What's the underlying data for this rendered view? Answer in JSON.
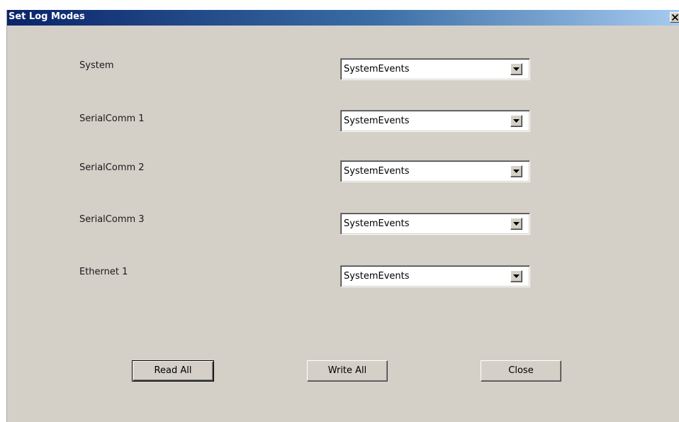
{
  "window": {
    "title": "Set Log Modes",
    "close_glyph": "X"
  },
  "rows": [
    {
      "label": "System",
      "value": "SystemEvents"
    },
    {
      "label": "SerialComm 1",
      "value": "SystemEvents"
    },
    {
      "label": "SerialComm 2",
      "value": "SystemEvents"
    },
    {
      "label": "SerialComm 3",
      "value": "SystemEvents"
    },
    {
      "label": "Ethernet 1",
      "value": "SystemEvents"
    }
  ],
  "buttons": {
    "read_all": "Read All",
    "write_all": "Write All",
    "close": "Close"
  },
  "icons": {
    "close": "close-icon",
    "dropdown": "chevron-down-icon"
  },
  "colors": {
    "titlebar_start": "#0a246a",
    "titlebar_end": "#a6caf0",
    "dialog_bg": "#d4d0c8"
  }
}
